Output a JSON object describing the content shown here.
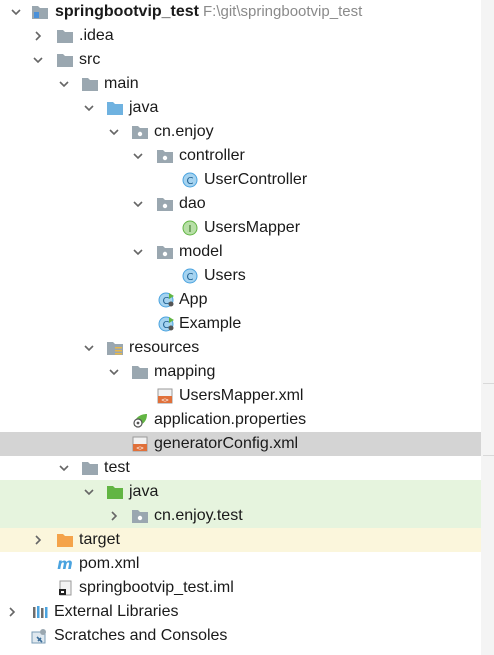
{
  "project": {
    "name": "springbootvip_test",
    "path": "F:\\git\\springbootvip_test"
  },
  "nodes": {
    "idea": ".idea",
    "src": "src",
    "main": "main",
    "java": "java",
    "cn_enjoy": "cn.enjoy",
    "controller": "controller",
    "user_controller": "UserController",
    "dao": "dao",
    "users_mapper": "UsersMapper",
    "model": "model",
    "users": "Users",
    "app": "App",
    "example": "Example",
    "resources": "resources",
    "mapping": "mapping",
    "users_mapper_xml": "UsersMapper.xml",
    "application_properties": "application.properties",
    "generator_config": "generatorConfig.xml",
    "test": "test",
    "test_java": "java",
    "cn_enjoy_test": "cn.enjoy.test",
    "target": "target",
    "pom": "pom.xml",
    "iml": "springbootvip_test.iml",
    "external_libraries": "External Libraries",
    "scratches": "Scratches and Consoles"
  },
  "icons": {
    "folder": "folder-icon",
    "source_folder": "source-folder-icon",
    "package": "package-icon",
    "class": "class-icon",
    "interface": "interface-icon",
    "spring_boot_class": "spring-boot-class-icon",
    "resources_folder": "resources-folder-icon",
    "xml_file": "xml-file-icon",
    "properties_file": "properties-file-icon",
    "maven_file": "maven-icon",
    "iml_file": "iml-file-icon",
    "libraries": "libraries-icon",
    "scratches": "scratches-icon"
  },
  "colors": {
    "selection": "#d4d4d4",
    "test_highlight": "#e6f4de",
    "excluded_highlight": "#fbf6dc",
    "folder_gray": "#9aa7b0",
    "source_blue": "#6fb2e0",
    "test_green": "#62b543",
    "excluded_orange": "#f4a34a",
    "class_blue": "#4aa3df",
    "interface_green": "#62b543"
  }
}
